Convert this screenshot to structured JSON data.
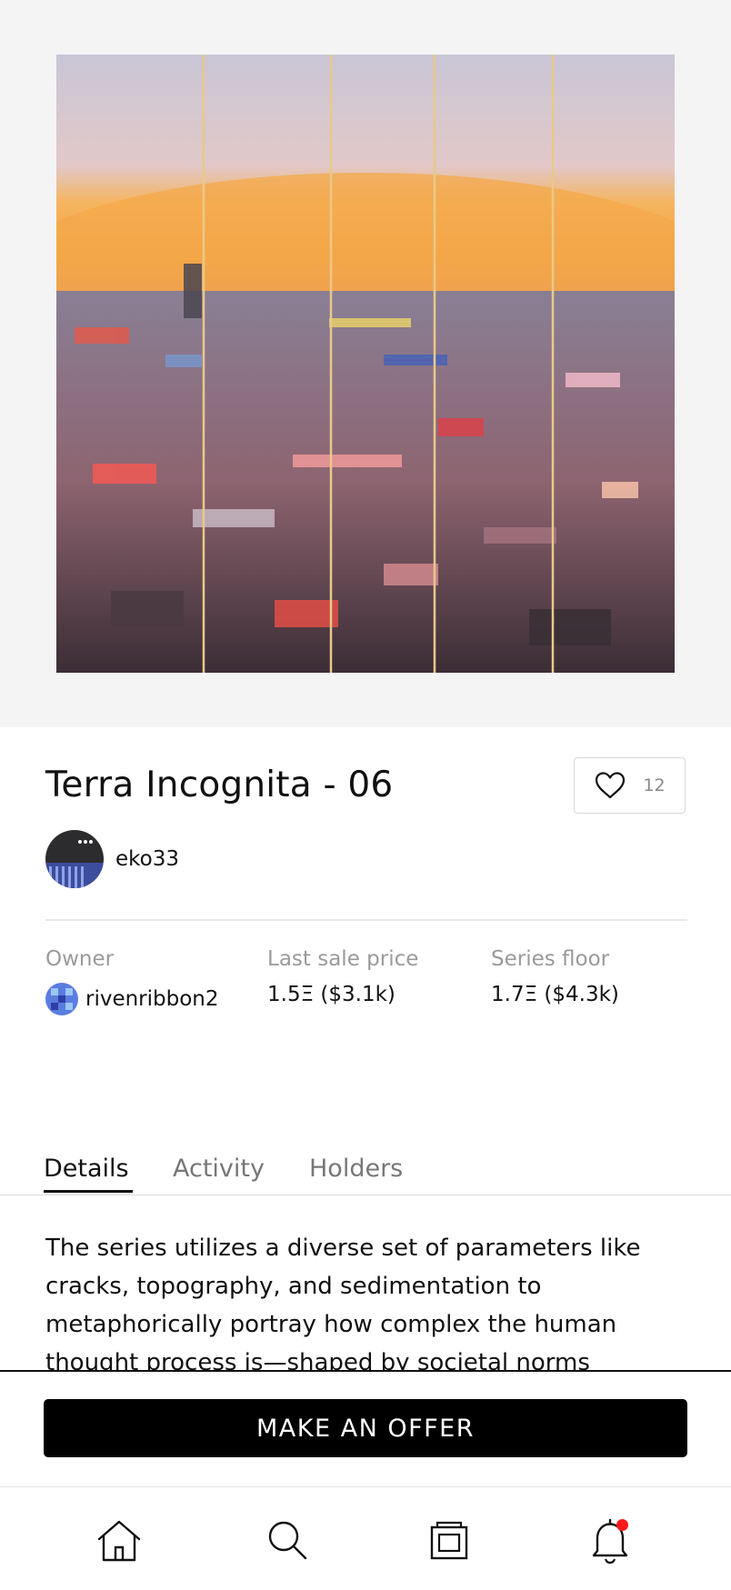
{
  "artwork": {
    "alt": "Terra Incognita - 06 artwork"
  },
  "title": "Terra Incognita - 06",
  "likes": {
    "count": "12"
  },
  "artist": {
    "name": "eko33"
  },
  "stats": {
    "owner": {
      "label": "Owner",
      "value": "rivenribbon2"
    },
    "last_sale": {
      "label": "Last sale price",
      "value": "1.5Ξ ($3.1k)"
    },
    "series_floor": {
      "label": "Series floor",
      "value": "1.7Ξ ($4.3k)"
    }
  },
  "tabs": [
    {
      "label": "Details",
      "active": true
    },
    {
      "label": "Activity",
      "active": false
    },
    {
      "label": "Holders",
      "active": false
    }
  ],
  "description": "The series utilizes a diverse set of parameters like cracks, topography, and sedimentation to metaphorically portray how complex the human thought process is—shaped by societal norms",
  "cta": {
    "label": "MAKE AN OFFER"
  },
  "nav": {
    "items": [
      {
        "icon": "home-icon"
      },
      {
        "icon": "search-icon"
      },
      {
        "icon": "collection-icon"
      },
      {
        "icon": "bell-icon",
        "has_notification": true
      }
    ]
  },
  "colors": {
    "accent": "#000000",
    "notification": "#ff1a1a",
    "muted_text": "#9a9a9a"
  }
}
